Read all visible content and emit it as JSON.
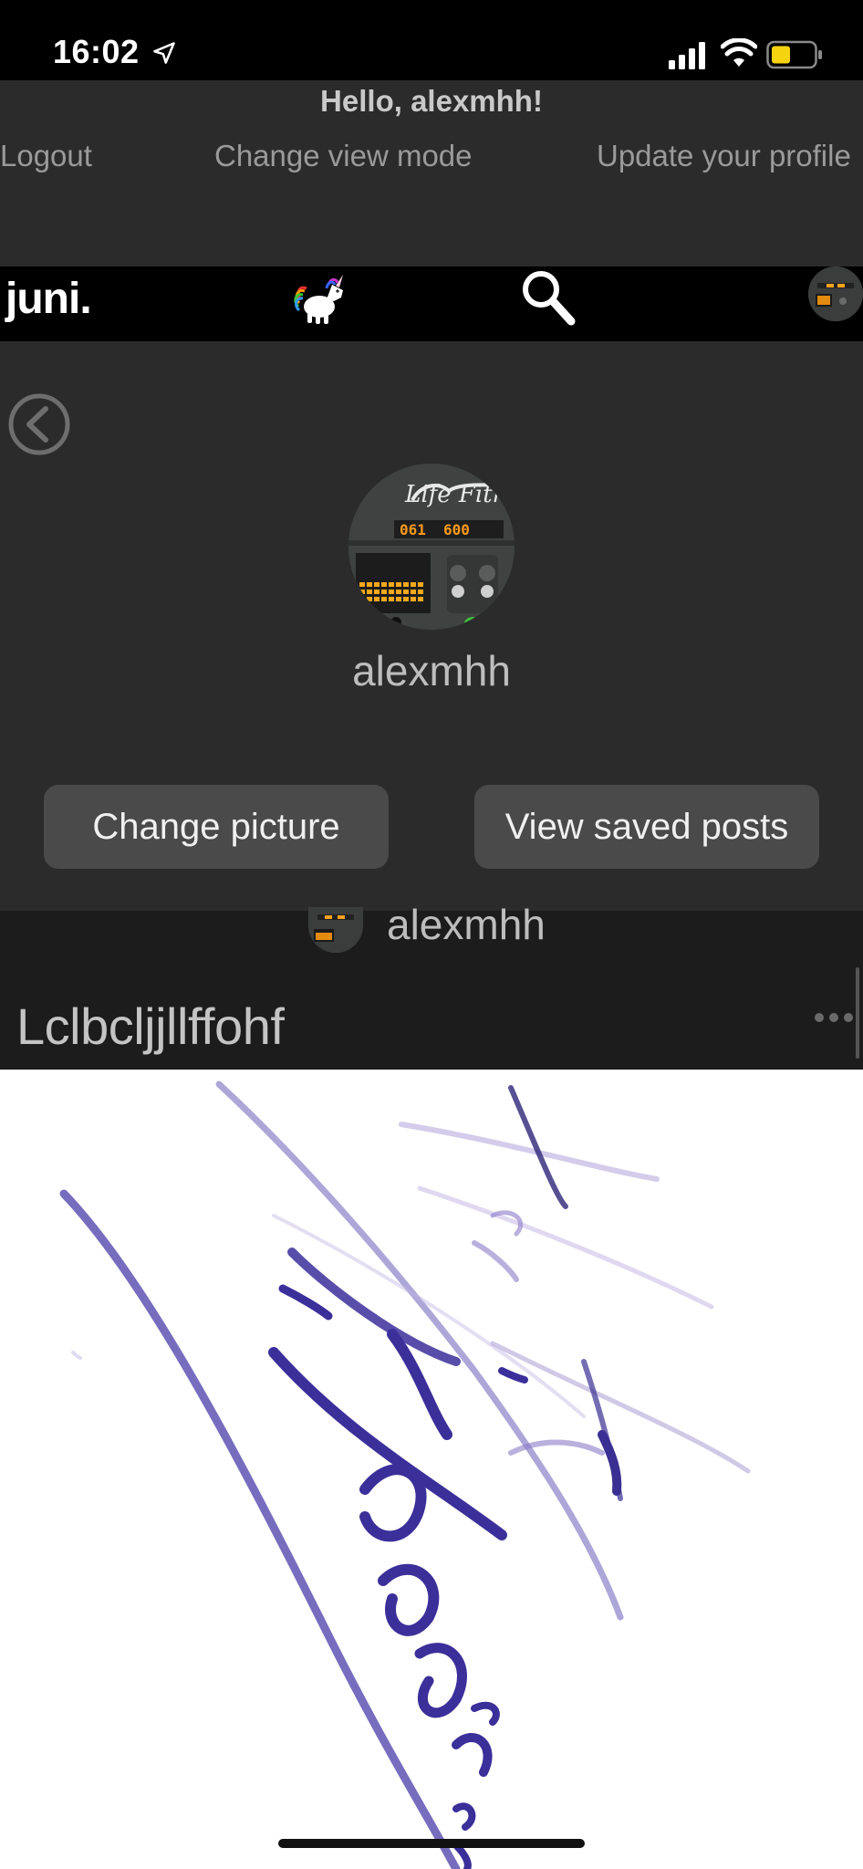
{
  "status_bar": {
    "time": "16:02",
    "icons": [
      "location-arrow-icon",
      "signal-icon",
      "wifi-icon",
      "battery-icon"
    ],
    "battery_color": "#f5d30f"
  },
  "header": {
    "greeting": "Hello, alexmhh!",
    "nav": {
      "logout": "Logout",
      "change_view": "Change view mode",
      "update_profile": "Update your profile"
    }
  },
  "app_bar": {
    "brand": "juni.",
    "icons": [
      "unicorn-icon",
      "search-icon",
      "avatar"
    ]
  },
  "profile": {
    "username": "alexmhh",
    "buttons": {
      "change_picture": "Change picture",
      "view_saved": "View saved posts"
    }
  },
  "post": {
    "author": "alexmhh",
    "title": "Lclbcljjllffohf",
    "image": "handwritten-ink-signature"
  },
  "colors": {
    "background": "#2b2b2b",
    "app_bar": "#000000",
    "button": "#4a4a4a",
    "post_header": "#1c1c1c",
    "ink": "#3b2f9a"
  }
}
